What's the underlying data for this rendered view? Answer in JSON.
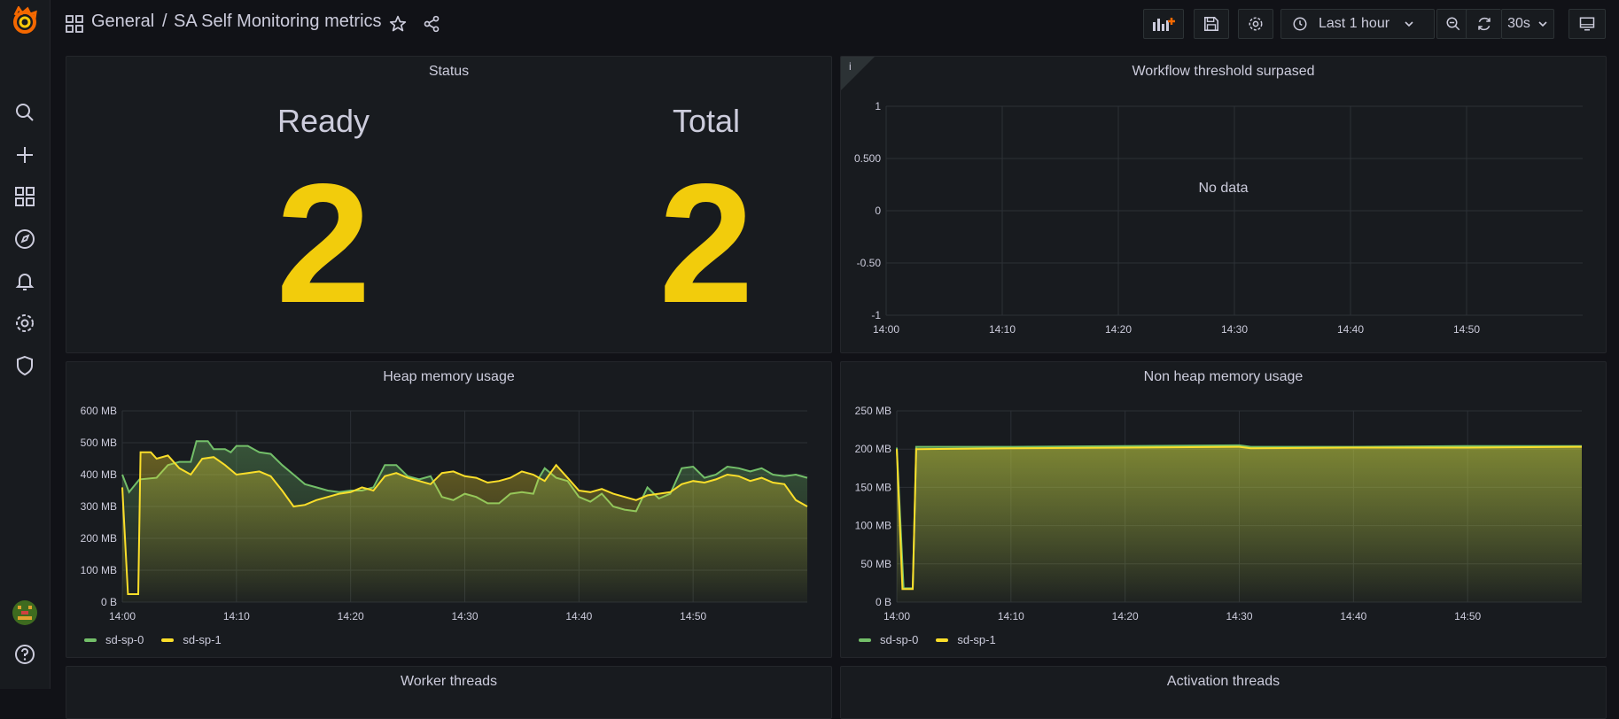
{
  "sidemenu": {
    "items": [
      "grafana-logo",
      "search-icon",
      "plus-icon",
      "dashboards-icon",
      "explore-icon",
      "alerting-icon",
      "configuration-icon",
      "shield-icon"
    ],
    "bottom": [
      "avatar",
      "help-icon"
    ]
  },
  "breadcrumb": {
    "folder": "General",
    "separator": "/",
    "title": "SA Self Monitoring metrics"
  },
  "toolbar": {
    "time_range": "Last 1 hour",
    "refresh_interval": "30s"
  },
  "colors": {
    "accent": "#f2cc0c",
    "series_green": "#73bf69",
    "series_yellow": "#fade2a",
    "background": "#111217",
    "panel": "#181b1f"
  },
  "status_panel": {
    "title": "Status",
    "stats": [
      {
        "label": "Ready",
        "value": "2"
      },
      {
        "label": "Total",
        "value": "2"
      }
    ]
  },
  "workflow_panel": {
    "title": "Workflow threshold surpased",
    "info_badge": "i",
    "message": "No data"
  },
  "heap_panel": {
    "title": "Heap memory usage"
  },
  "nonheap_panel": {
    "title": "Non heap memory usage"
  },
  "worker_panel": {
    "title": "Worker threads"
  },
  "activation_panel": {
    "title": "Activation threads"
  },
  "chart_data": [
    {
      "type": "line",
      "title": "Workflow threshold surpased",
      "x_ticks": [
        "14:00",
        "14:10",
        "14:20",
        "14:30",
        "14:40",
        "14:50"
      ],
      "y_ticks": [
        "1",
        "0.500",
        "0",
        "-0.50",
        "-1"
      ],
      "ylim": [
        -1,
        1
      ],
      "grid": true,
      "series": []
    },
    {
      "type": "area",
      "title": "Heap memory usage",
      "unit": "MB",
      "x_ticks": [
        "14:00",
        "14:10",
        "14:20",
        "14:30",
        "14:40",
        "14:50"
      ],
      "y_ticks": [
        "0 B",
        "100 MB",
        "200 MB",
        "300 MB",
        "400 MB",
        "500 MB",
        "600 MB"
      ],
      "ylim": [
        0,
        600
      ],
      "x_minutes": [
        0,
        60
      ],
      "grid": true,
      "legend_position": "bottom-left",
      "series": [
        {
          "name": "sd-sp-0",
          "color": "#73bf69",
          "points": [
            [
              0,
              400
            ],
            [
              0.6,
              345
            ],
            [
              1.5,
              385
            ],
            [
              3,
              390
            ],
            [
              4,
              430
            ],
            [
              5,
              440
            ],
            [
              6,
              440
            ],
            [
              6.5,
              505
            ],
            [
              7.5,
              505
            ],
            [
              8,
              480
            ],
            [
              9,
              480
            ],
            [
              9.5,
              470
            ],
            [
              10,
              490
            ],
            [
              11,
              490
            ],
            [
              12,
              470
            ],
            [
              13,
              465
            ],
            [
              14,
              430
            ],
            [
              15,
              400
            ],
            [
              16,
              370
            ],
            [
              17,
              360
            ],
            [
              18,
              350
            ],
            [
              19,
              345
            ],
            [
              20,
              350
            ],
            [
              21,
              350
            ],
            [
              22,
              360
            ],
            [
              23,
              430
            ],
            [
              24,
              430
            ],
            [
              25,
              395
            ],
            [
              26,
              385
            ],
            [
              27,
              395
            ],
            [
              28,
              330
            ],
            [
              29,
              320
            ],
            [
              30,
              340
            ],
            [
              31,
              330
            ],
            [
              32,
              310
            ],
            [
              33,
              310
            ],
            [
              34,
              340
            ],
            [
              35,
              345
            ],
            [
              36,
              340
            ],
            [
              36.5,
              390
            ],
            [
              37,
              420
            ],
            [
              38,
              390
            ],
            [
              39,
              380
            ],
            [
              40,
              330
            ],
            [
              41,
              315
            ],
            [
              42,
              340
            ],
            [
              43,
              300
            ],
            [
              44,
              290
            ],
            [
              45,
              285
            ],
            [
              46,
              360
            ],
            [
              47,
              325
            ],
            [
              48,
              340
            ],
            [
              49,
              420
            ],
            [
              50,
              425
            ],
            [
              51,
              390
            ],
            [
              52,
              400
            ],
            [
              53,
              425
            ],
            [
              54,
              420
            ],
            [
              55,
              410
            ],
            [
              56,
              420
            ],
            [
              57,
              400
            ],
            [
              58,
              395
            ],
            [
              59,
              400
            ],
            [
              60,
              390
            ]
          ]
        },
        {
          "name": "sd-sp-1",
          "color": "#fade2a",
          "points": [
            [
              0,
              360
            ],
            [
              0.5,
              25
            ],
            [
              1.4,
              25
            ],
            [
              1.6,
              470
            ],
            [
              2.5,
              470
            ],
            [
              3,
              450
            ],
            [
              4,
              460
            ],
            [
              5,
              420
            ],
            [
              6,
              400
            ],
            [
              7,
              450
            ],
            [
              8,
              455
            ],
            [
              9,
              430
            ],
            [
              10,
              400
            ],
            [
              11,
              405
            ],
            [
              12,
              410
            ],
            [
              13,
              395
            ],
            [
              14,
              350
            ],
            [
              15,
              300
            ],
            [
              16,
              305
            ],
            [
              17,
              320
            ],
            [
              18,
              330
            ],
            [
              19,
              340
            ],
            [
              20,
              345
            ],
            [
              21,
              360
            ],
            [
              22,
              350
            ],
            [
              23,
              395
            ],
            [
              24,
              405
            ],
            [
              25,
              390
            ],
            [
              26,
              380
            ],
            [
              27,
              370
            ],
            [
              28,
              405
            ],
            [
              29,
              410
            ],
            [
              30,
              395
            ],
            [
              31,
              390
            ],
            [
              32,
              375
            ],
            [
              33,
              380
            ],
            [
              34,
              390
            ],
            [
              35,
              410
            ],
            [
              36,
              400
            ],
            [
              37,
              380
            ],
            [
              38,
              430
            ],
            [
              39,
              390
            ],
            [
              40,
              350
            ],
            [
              41,
              345
            ],
            [
              42,
              355
            ],
            [
              43,
              340
            ],
            [
              44,
              330
            ],
            [
              45,
              320
            ],
            [
              46,
              335
            ],
            [
              47,
              340
            ],
            [
              48,
              345
            ],
            [
              49,
              370
            ],
            [
              50,
              380
            ],
            [
              51,
              375
            ],
            [
              52,
              385
            ],
            [
              53,
              400
            ],
            [
              54,
              395
            ],
            [
              55,
              380
            ],
            [
              56,
              390
            ],
            [
              57,
              375
            ],
            [
              58,
              370
            ],
            [
              59,
              320
            ],
            [
              60,
              300
            ]
          ]
        }
      ]
    },
    {
      "type": "area",
      "title": "Non heap memory usage",
      "unit": "MB",
      "x_ticks": [
        "14:00",
        "14:10",
        "14:20",
        "14:30",
        "14:40",
        "14:50"
      ],
      "y_ticks": [
        "0 B",
        "50 MB",
        "100 MB",
        "150 MB",
        "200 MB",
        "250 MB"
      ],
      "ylim": [
        0,
        250
      ],
      "x_minutes": [
        0,
        60
      ],
      "grid": true,
      "legend_position": "bottom-left",
      "series": [
        {
          "name": "sd-sp-0",
          "color": "#73bf69",
          "points": [
            [
              0,
              202
            ],
            [
              0.6,
              18
            ],
            [
              1.4,
              18
            ],
            [
              1.7,
              203
            ],
            [
              10,
              203
            ],
            [
              20,
              204
            ],
            [
              30,
              205
            ],
            [
              31,
              203
            ],
            [
              40,
              203
            ],
            [
              50,
              204
            ],
            [
              60,
              204
            ]
          ]
        },
        {
          "name": "sd-sp-1",
          "color": "#fade2a",
          "points": [
            [
              0,
              200
            ],
            [
              0.5,
              17
            ],
            [
              1.4,
              17
            ],
            [
              1.7,
              200
            ],
            [
              10,
              201
            ],
            [
              20,
              202
            ],
            [
              30,
              203
            ],
            [
              31,
              201
            ],
            [
              40,
              202
            ],
            [
              50,
              202
            ],
            [
              60,
              203
            ]
          ]
        }
      ]
    }
  ]
}
